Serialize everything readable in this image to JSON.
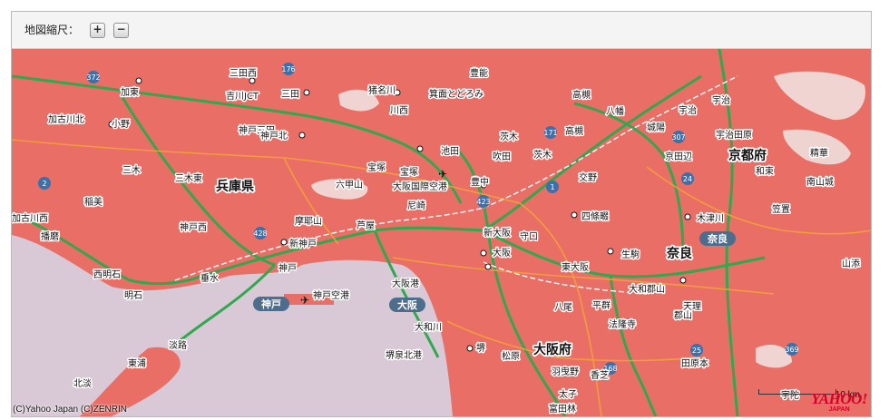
{
  "toolbar": {
    "zoom_label": "地図縮尺：",
    "zoom_in": "+",
    "zoom_out": "−"
  },
  "map": {
    "copyright": "(C)Yahoo Japan (C)ZENRIN",
    "scale_label": "10 km",
    "brand": "YAHOO!",
    "brand_sub": "JAPAN",
    "colors": {
      "land": "#e96e66",
      "sea": "#d9c9d6",
      "expressway": "#2fa84f",
      "road": "#f2a13a",
      "forest": "#f0e6e4"
    },
    "prefectures": [
      "兵庫県",
      "京都府",
      "大阪府",
      "奈良"
    ],
    "boxed_labels": [
      "神戸",
      "大阪",
      "奈良"
    ],
    "places": [
      "三田西",
      "吉川JCT",
      "三田",
      "猪名川",
      "箕面とどろみ",
      "豊能",
      "加東",
      "神戸三田",
      "川西",
      "高槻",
      "八幡",
      "宇治",
      "加古川北",
      "小野",
      "神戸北",
      "池田",
      "茨木",
      "高槻",
      "城陽",
      "宇治田原",
      "宝塚",
      "吹田",
      "茨木",
      "京田辺",
      "三木",
      "三木東",
      "宝塚",
      "豊中",
      "交野",
      "和束",
      "六甲山",
      "大阪国際空港",
      "尼崎",
      "南山城",
      "稲美",
      "神戸西",
      "摩耶山",
      "芦屋",
      "新大阪",
      "四條畷",
      "笠置",
      "加古川西",
      "新神戸",
      "大阪",
      "守口",
      "木津川",
      "播磨",
      "神戸",
      "生駒",
      "東大阪",
      "西明石",
      "垂水",
      "大和郡山",
      "山添",
      "明石",
      "神戸空港",
      "大阪港",
      "八尾",
      "平群",
      "天理",
      "大和川",
      "法隆寺",
      "郡山",
      "淡路",
      "堺泉北港",
      "堺",
      "松原",
      "羽曳野",
      "香芝",
      "田原本",
      "東浦",
      "北淡",
      "太子",
      "富田林",
      "宇陀",
      "宇治",
      "精華"
    ],
    "route_numbers": [
      "372",
      "176",
      "171",
      "307",
      "24",
      "2",
      "931",
      "702",
      "428",
      "423",
      "1",
      "168",
      "25",
      "369"
    ]
  }
}
